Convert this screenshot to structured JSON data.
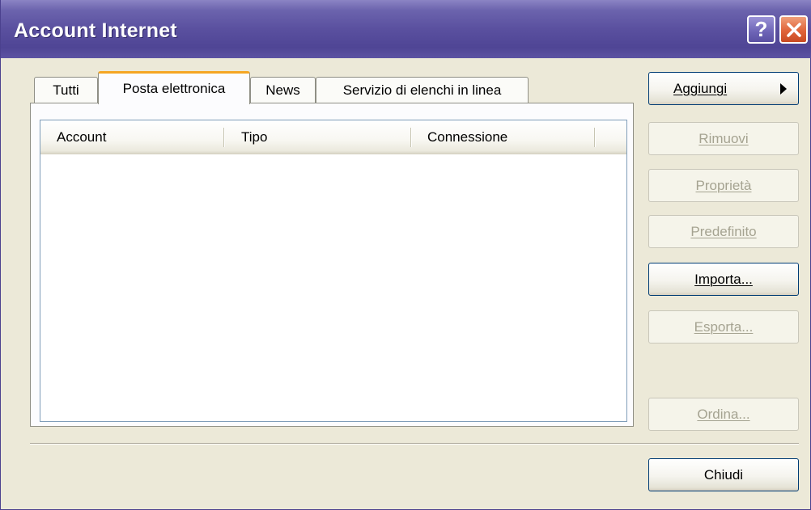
{
  "window": {
    "title": "Account Internet",
    "help_label": "?"
  },
  "tabs": [
    {
      "label": "Tutti",
      "active": false
    },
    {
      "label": "Posta elettronica",
      "active": true
    },
    {
      "label": "News",
      "active": false
    },
    {
      "label": "Servizio di elenchi in linea",
      "active": false
    }
  ],
  "list": {
    "columns": [
      "Account",
      "Tipo",
      "Connessione"
    ],
    "rows": []
  },
  "buttons": {
    "add": "Aggiungi",
    "remove": "Rimuovi",
    "properties": "Proprietà",
    "default": "Predefinito",
    "import": "Importa...",
    "export": "Esporta...",
    "order": "Ordina...",
    "close": "Chiudi"
  },
  "icons": {
    "help": "help-icon",
    "close": "close-icon",
    "submenu": "triangle-right-icon"
  },
  "colors": {
    "titlebar": "#5a509f",
    "dialog_bg": "#ece9d8",
    "active_tab_accent": "#f5a623",
    "close_button": "#e0643a"
  }
}
